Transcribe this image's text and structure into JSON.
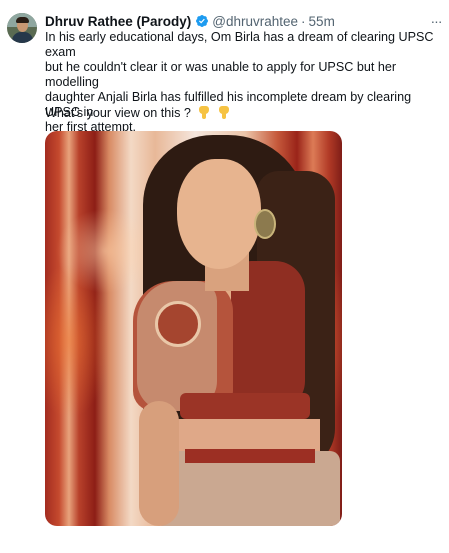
{
  "tweet": {
    "display_name": "Dhruv Rathee (Parody)",
    "handle": "@dhruvrahtee",
    "separator": "·",
    "time": "55m",
    "more_label": "···",
    "body_lines": [
      "In his early educational days, Om Birla has a dream of clearing UPSC exam",
      "but he couldn't clear it or was unable to apply for UPSC but her modelling",
      "daughter Anjali Birla has fulfilled his incomplete dream by clearing UPSC in",
      "her first attempt."
    ],
    "question": "What's your view on this ?",
    "question_emojis": [
      "pointing-down-hand",
      "pointing-down-hand"
    ]
  },
  "icons": {
    "verified": "verified-badge-icon",
    "more": "more-options-icon",
    "verified_color": "#1d9bf0"
  },
  "colors": {
    "text": "#0f1419",
    "secondary": "#536471",
    "background": "#ffffff"
  }
}
